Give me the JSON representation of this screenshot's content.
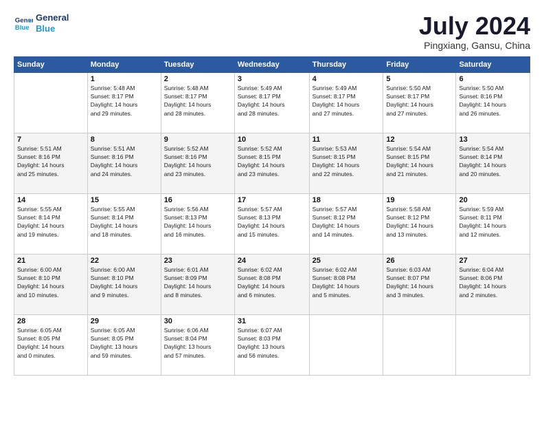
{
  "logo": {
    "line1": "General",
    "line2": "Blue"
  },
  "title": "July 2024",
  "subtitle": "Pingxiang, Gansu, China",
  "weekdays": [
    "Sunday",
    "Monday",
    "Tuesday",
    "Wednesday",
    "Thursday",
    "Friday",
    "Saturday"
  ],
  "weeks": [
    [
      {
        "day": "",
        "info": ""
      },
      {
        "day": "1",
        "info": "Sunrise: 5:48 AM\nSunset: 8:17 PM\nDaylight: 14 hours\nand 29 minutes."
      },
      {
        "day": "2",
        "info": "Sunrise: 5:48 AM\nSunset: 8:17 PM\nDaylight: 14 hours\nand 28 minutes."
      },
      {
        "day": "3",
        "info": "Sunrise: 5:49 AM\nSunset: 8:17 PM\nDaylight: 14 hours\nand 28 minutes."
      },
      {
        "day": "4",
        "info": "Sunrise: 5:49 AM\nSunset: 8:17 PM\nDaylight: 14 hours\nand 27 minutes."
      },
      {
        "day": "5",
        "info": "Sunrise: 5:50 AM\nSunset: 8:17 PM\nDaylight: 14 hours\nand 27 minutes."
      },
      {
        "day": "6",
        "info": "Sunrise: 5:50 AM\nSunset: 8:16 PM\nDaylight: 14 hours\nand 26 minutes."
      }
    ],
    [
      {
        "day": "7",
        "info": "Sunrise: 5:51 AM\nSunset: 8:16 PM\nDaylight: 14 hours\nand 25 minutes."
      },
      {
        "day": "8",
        "info": "Sunrise: 5:51 AM\nSunset: 8:16 PM\nDaylight: 14 hours\nand 24 minutes."
      },
      {
        "day": "9",
        "info": "Sunrise: 5:52 AM\nSunset: 8:16 PM\nDaylight: 14 hours\nand 23 minutes."
      },
      {
        "day": "10",
        "info": "Sunrise: 5:52 AM\nSunset: 8:15 PM\nDaylight: 14 hours\nand 23 minutes."
      },
      {
        "day": "11",
        "info": "Sunrise: 5:53 AM\nSunset: 8:15 PM\nDaylight: 14 hours\nand 22 minutes."
      },
      {
        "day": "12",
        "info": "Sunrise: 5:54 AM\nSunset: 8:15 PM\nDaylight: 14 hours\nand 21 minutes."
      },
      {
        "day": "13",
        "info": "Sunrise: 5:54 AM\nSunset: 8:14 PM\nDaylight: 14 hours\nand 20 minutes."
      }
    ],
    [
      {
        "day": "14",
        "info": "Sunrise: 5:55 AM\nSunset: 8:14 PM\nDaylight: 14 hours\nand 19 minutes."
      },
      {
        "day": "15",
        "info": "Sunrise: 5:55 AM\nSunset: 8:14 PM\nDaylight: 14 hours\nand 18 minutes."
      },
      {
        "day": "16",
        "info": "Sunrise: 5:56 AM\nSunset: 8:13 PM\nDaylight: 14 hours\nand 16 minutes."
      },
      {
        "day": "17",
        "info": "Sunrise: 5:57 AM\nSunset: 8:13 PM\nDaylight: 14 hours\nand 15 minutes."
      },
      {
        "day": "18",
        "info": "Sunrise: 5:57 AM\nSunset: 8:12 PM\nDaylight: 14 hours\nand 14 minutes."
      },
      {
        "day": "19",
        "info": "Sunrise: 5:58 AM\nSunset: 8:12 PM\nDaylight: 14 hours\nand 13 minutes."
      },
      {
        "day": "20",
        "info": "Sunrise: 5:59 AM\nSunset: 8:11 PM\nDaylight: 14 hours\nand 12 minutes."
      }
    ],
    [
      {
        "day": "21",
        "info": "Sunrise: 6:00 AM\nSunset: 8:10 PM\nDaylight: 14 hours\nand 10 minutes."
      },
      {
        "day": "22",
        "info": "Sunrise: 6:00 AM\nSunset: 8:10 PM\nDaylight: 14 hours\nand 9 minutes."
      },
      {
        "day": "23",
        "info": "Sunrise: 6:01 AM\nSunset: 8:09 PM\nDaylight: 14 hours\nand 8 minutes."
      },
      {
        "day": "24",
        "info": "Sunrise: 6:02 AM\nSunset: 8:08 PM\nDaylight: 14 hours\nand 6 minutes."
      },
      {
        "day": "25",
        "info": "Sunrise: 6:02 AM\nSunset: 8:08 PM\nDaylight: 14 hours\nand 5 minutes."
      },
      {
        "day": "26",
        "info": "Sunrise: 6:03 AM\nSunset: 8:07 PM\nDaylight: 14 hours\nand 3 minutes."
      },
      {
        "day": "27",
        "info": "Sunrise: 6:04 AM\nSunset: 8:06 PM\nDaylight: 14 hours\nand 2 minutes."
      }
    ],
    [
      {
        "day": "28",
        "info": "Sunrise: 6:05 AM\nSunset: 8:05 PM\nDaylight: 14 hours\nand 0 minutes."
      },
      {
        "day": "29",
        "info": "Sunrise: 6:05 AM\nSunset: 8:05 PM\nDaylight: 13 hours\nand 59 minutes."
      },
      {
        "day": "30",
        "info": "Sunrise: 6:06 AM\nSunset: 8:04 PM\nDaylight: 13 hours\nand 57 minutes."
      },
      {
        "day": "31",
        "info": "Sunrise: 6:07 AM\nSunset: 8:03 PM\nDaylight: 13 hours\nand 56 minutes."
      },
      {
        "day": "",
        "info": ""
      },
      {
        "day": "",
        "info": ""
      },
      {
        "day": "",
        "info": ""
      }
    ]
  ]
}
